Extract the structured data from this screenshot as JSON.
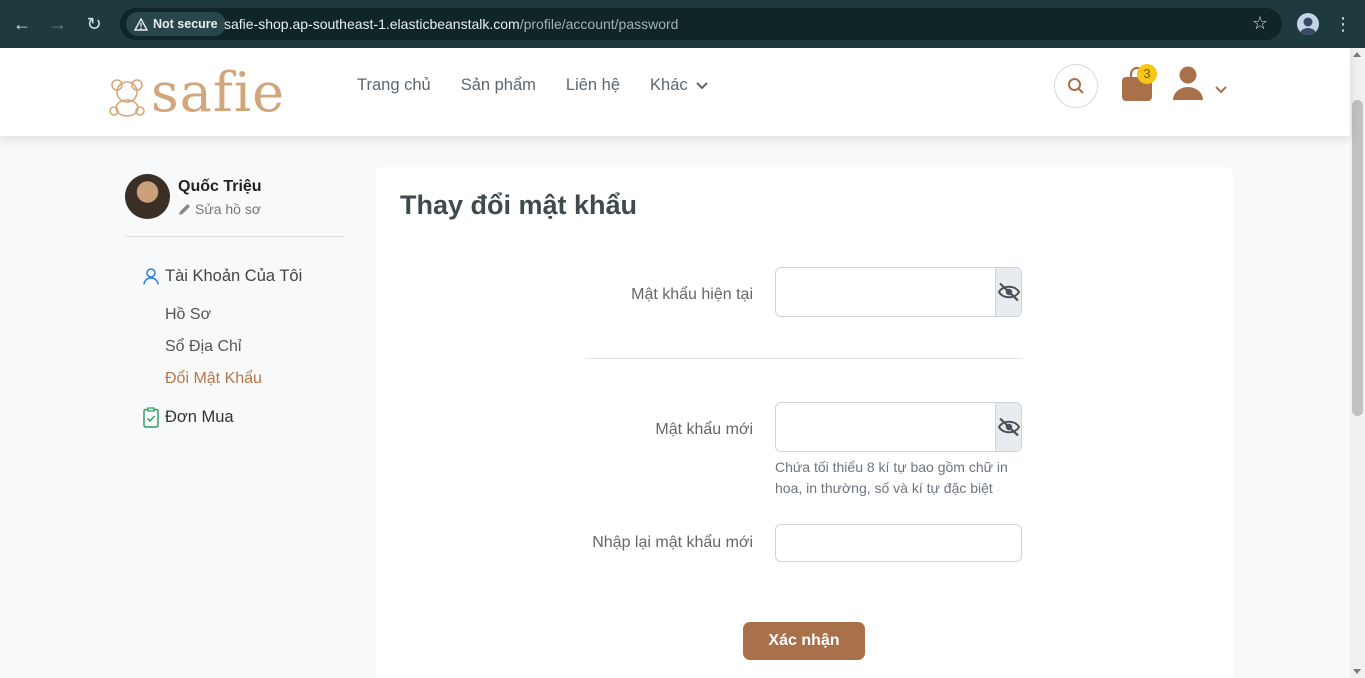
{
  "browser": {
    "security_label": "Not secure",
    "url_host": "safie-shop.ap-southeast-1.elasticbeanstalk.com",
    "url_path": "/profile/account/password"
  },
  "header": {
    "logo_text": "safie",
    "nav": {
      "home": "Trang chủ",
      "products": "Sản phẩm",
      "contact": "Liên hệ",
      "more": "Khác"
    },
    "cart_count": "3"
  },
  "sidebar": {
    "user_name": "Quốc Triệu",
    "edit_profile": "Sửa hồ sơ",
    "account_section": "Tài Khoản Của Tôi",
    "account_items": [
      "Hồ Sơ",
      "Sổ Địa Chỉ",
      "Đổi Mật Khẩu"
    ],
    "orders_section": "Đơn Mua"
  },
  "form": {
    "title": "Thay đổi mật khẩu",
    "current_password_label": "Mật khẩu hiện tại",
    "new_password_label": "Mật khẩu mới",
    "password_hint": "Chứa tối thiểu 8 kí tự bao gồm chữ in hoa, in thường, số và kí tự đặc biệt",
    "confirm_password_label": "Nhập lại mật khẩu mới",
    "submit_label": "Xác nhận"
  },
  "colors": {
    "brand": "#a9714a",
    "active_link": "#b5774a",
    "badge": "#f5c518"
  }
}
